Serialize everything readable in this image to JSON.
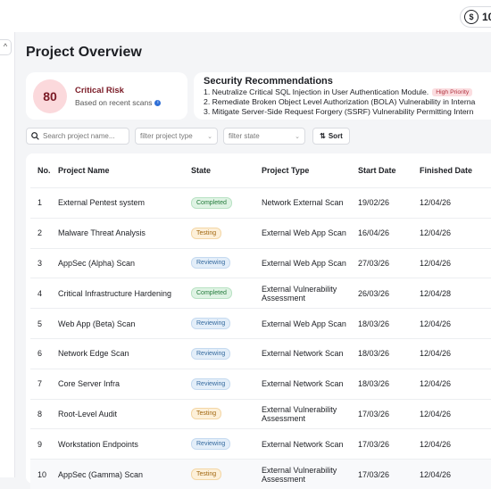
{
  "header": {
    "credits": "10"
  },
  "page": {
    "title": "Project Overview"
  },
  "risk": {
    "score": "80",
    "level": "Critical Risk",
    "subtitle": "Based on recent scans"
  },
  "recommendations": {
    "title": "Security Recommendations",
    "items": [
      "1. Neutralize Critical SQL Injection in User Authentication Module.",
      "2. Remediate Broken Object Level Authorization (BOLA) Vulnerability in Interna",
      "3. Mitigate Server-Side Request Forgery (SSRF) Vulnerability Permitting Intern"
    ],
    "priority_badge": "High Priority"
  },
  "filters": {
    "search_placeholder": "Search project name...",
    "project_type_placeholder": "filter project type",
    "state_placeholder": "filter state",
    "sort_label": "Sort"
  },
  "table": {
    "headers": {
      "no": "No.",
      "name": "Project Name",
      "state": "State",
      "type": "Project Type",
      "start": "Start Date",
      "finished": "Finished Date"
    },
    "rows": [
      {
        "no": "1",
        "name": "External Pentest system",
        "state": "Completed",
        "type": "Network External Scan",
        "start": "19/02/26",
        "finished": "12/04/26"
      },
      {
        "no": "2",
        "name": "Malware Threat Analysis",
        "state": "Testing",
        "type": "External Web App Scan",
        "start": "16/04/26",
        "finished": "12/04/26"
      },
      {
        "no": "3",
        "name": "AppSec (Alpha) Scan",
        "state": "Reviewing",
        "type": "External Web App Scan",
        "start": "27/03/26",
        "finished": "12/04/26"
      },
      {
        "no": "4",
        "name": "Critical Infrastructure Hardening",
        "state": "Completed",
        "type": "External Vulnerability Assessment",
        "start": "26/03/26",
        "finished": "12/04/28"
      },
      {
        "no": "5",
        "name": "Web App (Beta) Scan",
        "state": "Reviewing",
        "type": "External Web App Scan",
        "start": "18/03/26",
        "finished": "12/04/26"
      },
      {
        "no": "6",
        "name": "Network Edge Scan",
        "state": "Reviewing",
        "type": "External Network Scan",
        "start": "18/03/26",
        "finished": "12/04/26"
      },
      {
        "no": "7",
        "name": "Core Server Infra",
        "state": "Reviewing",
        "type": "External Network Scan",
        "start": "18/03/26",
        "finished": "12/04/26"
      },
      {
        "no": "8",
        "name": "Root-Level Audit",
        "state": "Testing",
        "type": "External Vulnerability Assessment",
        "start": "17/03/26",
        "finished": "12/04/26"
      },
      {
        "no": "9",
        "name": "Workstation Endpoints",
        "state": "Reviewing",
        "type": "External Network Scan",
        "start": "17/03/26",
        "finished": "12/04/26"
      },
      {
        "no": "10",
        "name": "AppSec (Gamma) Scan",
        "state": "Testing",
        "type": "External Vulnerability Assessment",
        "start": "17/03/26",
        "finished": "12/04/26"
      }
    ]
  }
}
